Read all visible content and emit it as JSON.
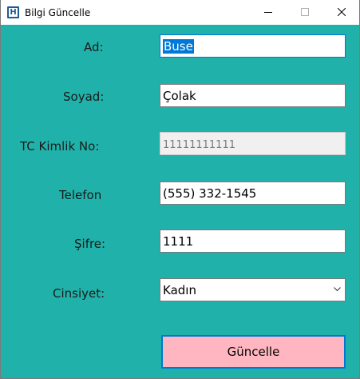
{
  "window": {
    "title": "Bilgi Güncelle",
    "icon_letter": "H"
  },
  "form": {
    "ad_label": "Ad:",
    "ad_value": "Buse",
    "soyad_label": "Soyad:",
    "soyad_value": "Çolak",
    "tc_label": "TC Kimlik No:",
    "tc_value": "11111111111",
    "telefon_label": "Telefon",
    "telefon_value": "(555) 332-1545",
    "sifre_label": "Şifre:",
    "sifre_value": "1111",
    "cinsiyet_label": "Cinsiyet:",
    "cinsiyet_value": "Kadın",
    "submit_label": "Güncelle"
  },
  "colors": {
    "background": "#20b2aa",
    "button": "#ffb6c1",
    "focus": "#0078d7"
  },
  "icons": {
    "app": "app-icon",
    "minimize": "minimize-icon",
    "maximize": "maximize-icon",
    "close": "close-icon",
    "dropdown": "chevron-down-icon"
  }
}
